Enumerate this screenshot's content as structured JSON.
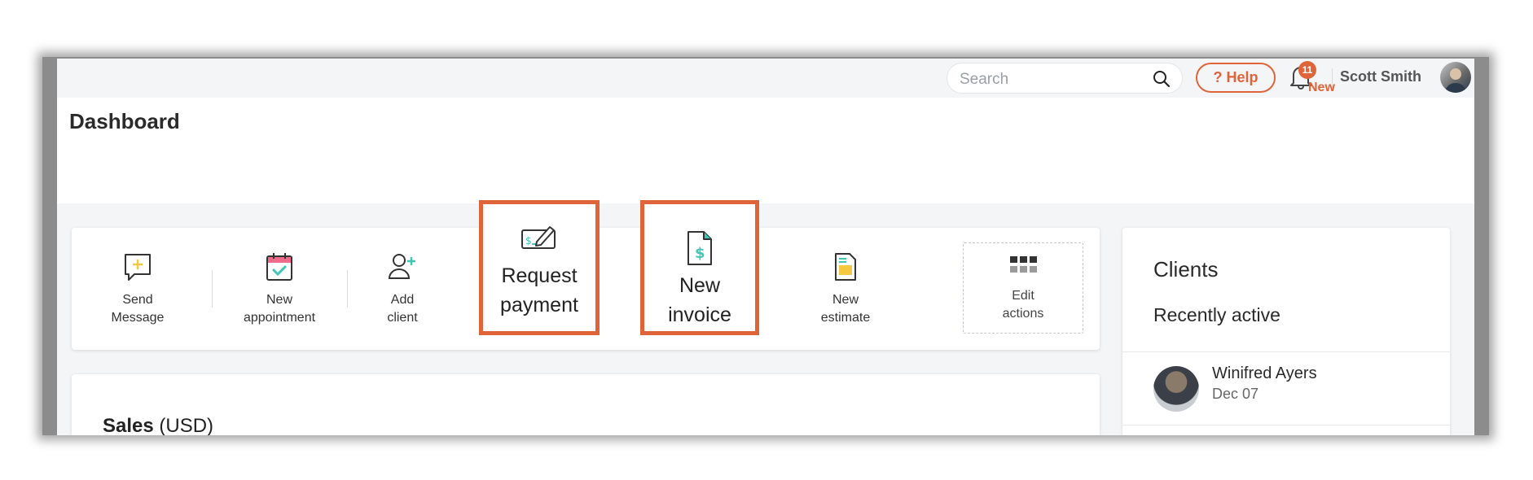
{
  "topbar": {
    "search_placeholder": "Search",
    "help_label": "? Help",
    "notification_count": "11",
    "notification_new_label": "New",
    "user_name": "Scott Smith"
  },
  "page": {
    "title": "Dashboard"
  },
  "quick_actions": [
    {
      "label_line1": "Send",
      "label_line2": "Message",
      "icon": "message-plus-icon"
    },
    {
      "label_line1": "New",
      "label_line2": "appointment",
      "icon": "calendar-check-icon"
    },
    {
      "label_line1": "Add",
      "label_line2": "client",
      "icon": "add-user-icon"
    },
    {
      "label_line1": "Request",
      "label_line2": "payment",
      "icon": "request-payment-icon"
    },
    {
      "label_line1": "New",
      "label_line2": "invoice",
      "icon": "invoice-dollar-icon"
    },
    {
      "label_line1": "New",
      "label_line2": "estimate",
      "icon": "estimate-doc-icon"
    }
  ],
  "edit_actions": {
    "label_line1": "Edit",
    "label_line2": "actions"
  },
  "sales": {
    "title": "Sales",
    "currency": "(USD)"
  },
  "clients": {
    "title": "Clients",
    "subtitle": "Recently active",
    "items": [
      {
        "name": "Winifred Ayers",
        "date": "Dec 07"
      }
    ]
  },
  "colors": {
    "accent": "#e0643a",
    "teal": "#3fc7b5",
    "yellow": "#f5c842"
  }
}
